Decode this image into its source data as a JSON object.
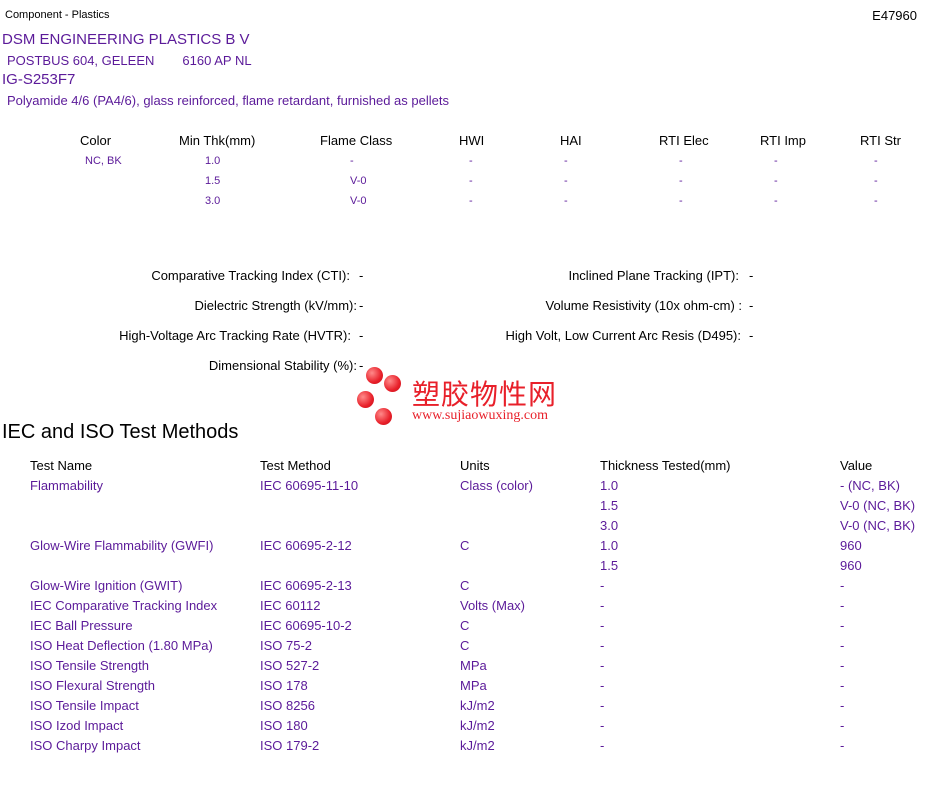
{
  "header": {
    "category": "Component - Plastics",
    "file_number": "E47960"
  },
  "company": {
    "name": "DSM ENGINEERING PLASTICS B V",
    "address_street": "POSTBUS 604, GELEEN",
    "address_postal": "6160 AP NL"
  },
  "product": {
    "grade": "IG-S253F7",
    "description": "Polyamide 4/6 (PA4/6), glass reinforced, flame retardant, furnished as pellets"
  },
  "color_table": {
    "headers": [
      "Color",
      "Min Thk(mm)",
      "Flame Class",
      "HWI",
      "HAI",
      "RTI Elec",
      "RTI Imp",
      "RTI Str"
    ],
    "rows": [
      [
        "NC, BK",
        "1.0",
        "-",
        "-",
        "-",
        "-",
        "-",
        "-"
      ],
      [
        "",
        "1.5",
        "V-0",
        "-",
        "-",
        "-",
        "-",
        "-"
      ],
      [
        "",
        "3.0",
        "V-0",
        "-",
        "-",
        "-",
        "-",
        "-"
      ]
    ]
  },
  "properties": {
    "left": [
      {
        "label": "Comparative Tracking Index (CTI):",
        "value": "-"
      },
      {
        "label": "Dielectric Strength (kV/mm):",
        "value": "-"
      },
      {
        "label": "High-Voltage Arc Tracking Rate (HVTR):",
        "value": "-"
      },
      {
        "label": "Dimensional Stability (%):",
        "value": "-"
      }
    ],
    "right": [
      {
        "label": "Inclined Plane Tracking (IPT):",
        "value": "-"
      },
      {
        "label": "Volume Resistivity (10x ohm-cm) :",
        "value": "-"
      },
      {
        "label": "High Volt, Low Current Arc Resis (D495):",
        "value": "-"
      }
    ]
  },
  "section_title": "IEC and ISO Test Methods",
  "test_methods": {
    "headers": [
      "Test Name",
      "Test Method",
      "Units",
      "Thickness Tested(mm)",
      "Value"
    ],
    "rows": [
      [
        "Flammability",
        "IEC 60695-11-10",
        "Class (color)",
        "1.0",
        "- (NC, BK)"
      ],
      [
        "",
        "",
        "",
        "1.5",
        "V-0 (NC, BK)"
      ],
      [
        "",
        "",
        "",
        "3.0",
        "V-0 (NC, BK)"
      ],
      [
        "Glow-Wire Flammability (GWFI)",
        "IEC 60695-2-12",
        "C",
        "1.0",
        "960"
      ],
      [
        "",
        "",
        "",
        "1.5",
        "960"
      ],
      [
        "Glow-Wire Ignition (GWIT)",
        "IEC 60695-2-13",
        "C",
        "-",
        "-"
      ],
      [
        "IEC Comparative Tracking Index",
        "IEC 60112",
        "Volts (Max)",
        "-",
        "-"
      ],
      [
        "IEC Ball Pressure",
        "IEC 60695-10-2",
        "C",
        "-",
        "-"
      ],
      [
        "ISO Heat Deflection (1.80 MPa)",
        "ISO 75-2",
        "C",
        "-",
        "-"
      ],
      [
        "ISO Tensile Strength",
        "ISO 527-2",
        "MPa",
        "-",
        "-"
      ],
      [
        "ISO Flexural Strength",
        "ISO 178",
        "MPa",
        "-",
        "-"
      ],
      [
        "ISO Tensile Impact",
        "ISO 8256",
        "kJ/m2",
        "-",
        "-"
      ],
      [
        "ISO Izod Impact",
        "ISO 180",
        "kJ/m2",
        "-",
        "-"
      ],
      [
        "ISO Charpy Impact",
        "ISO 179-2",
        "kJ/m2",
        "-",
        "-"
      ]
    ]
  },
  "watermark": {
    "chinese": "塑胶物性网",
    "url": "www.sujiaowuxing.com"
  },
  "colors": {
    "text_primary": "#000000",
    "text_accent": "#5b1a99",
    "watermark": "#e8202a"
  }
}
